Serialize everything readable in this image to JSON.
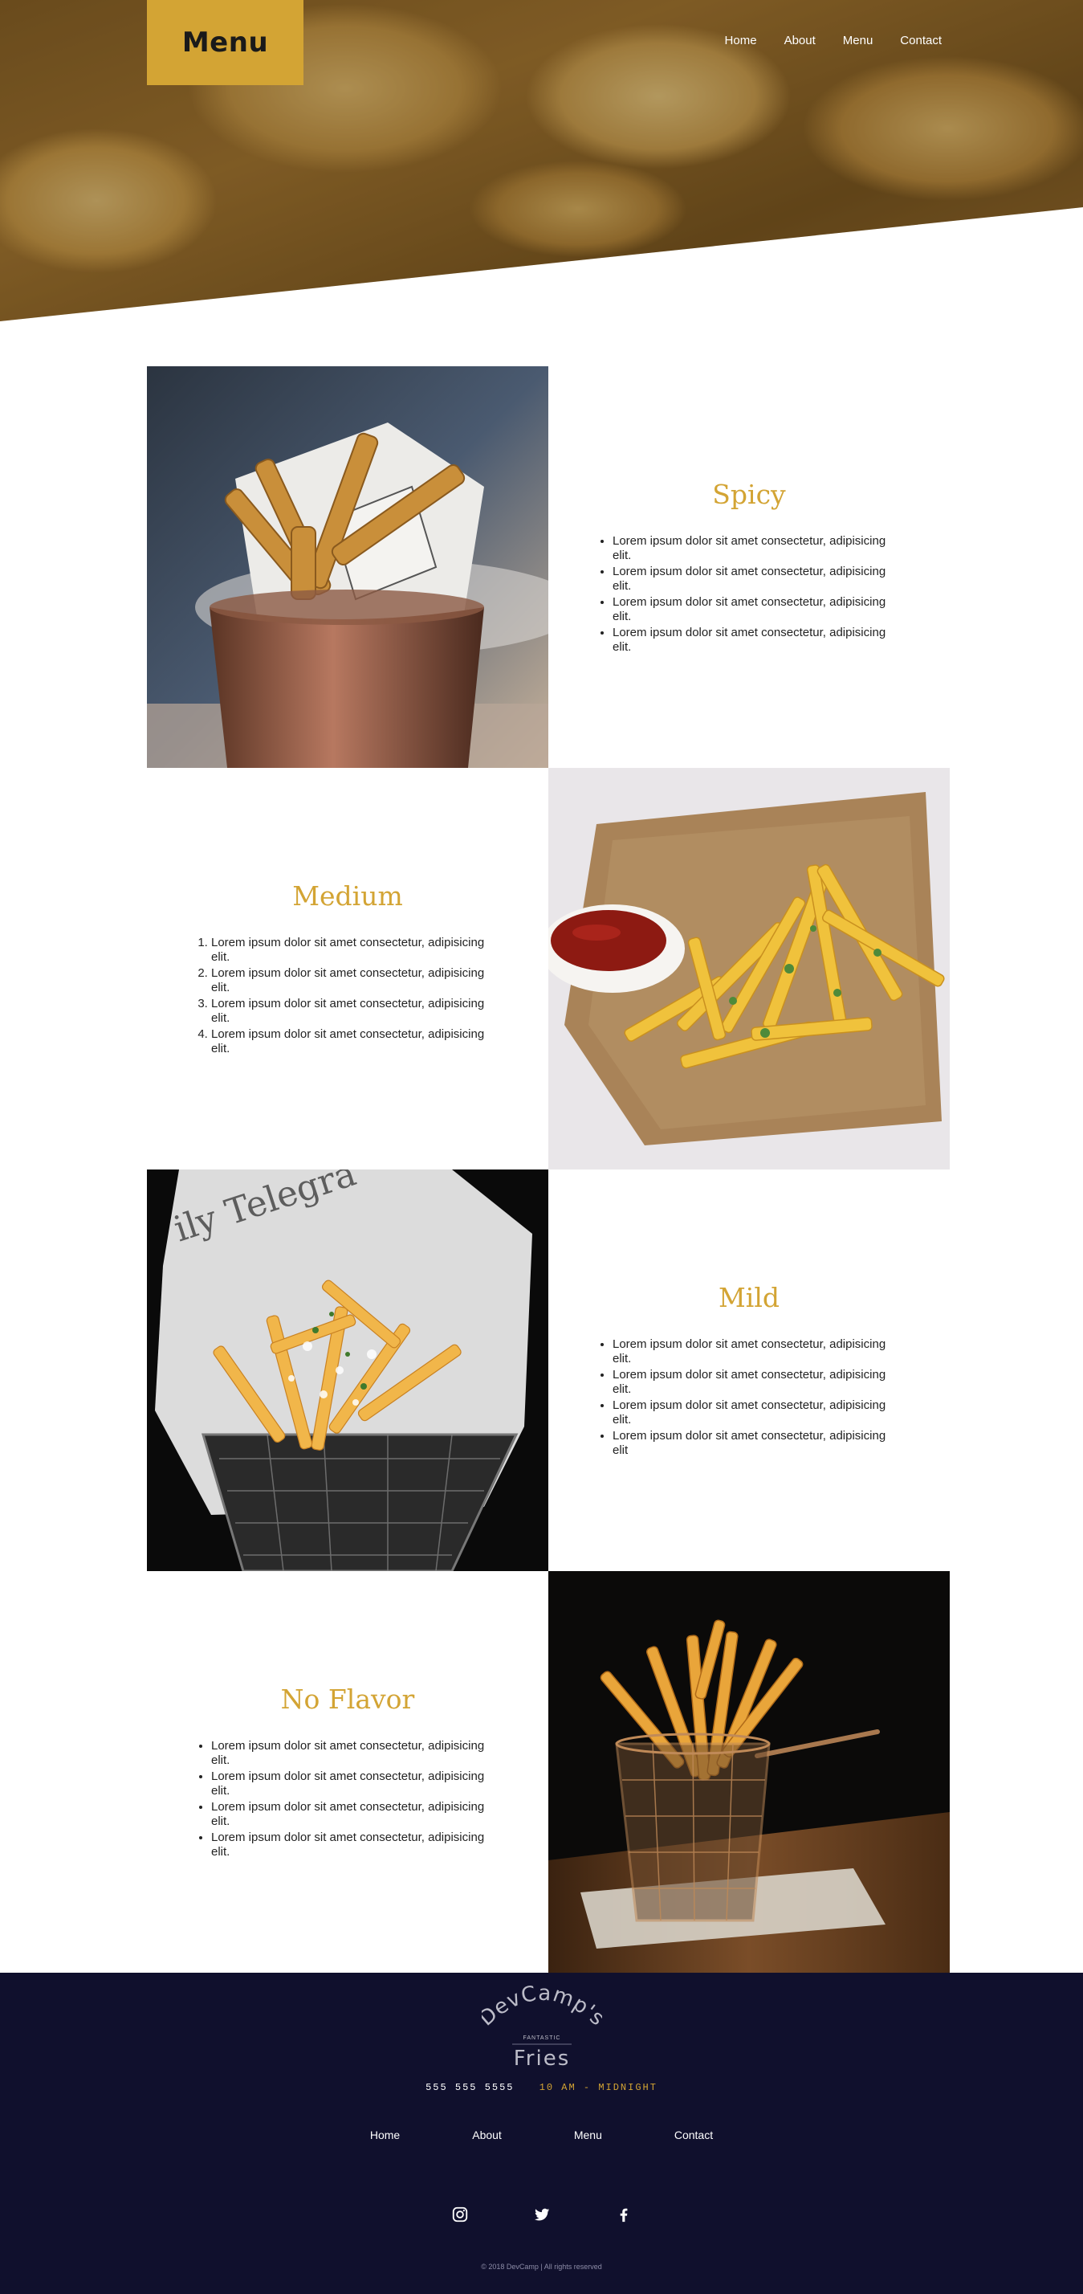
{
  "colors": {
    "accent": "#d3a434",
    "footer_bg": "#10102d",
    "text": "#222222"
  },
  "header": {
    "brand_label": "Menu",
    "nav": [
      "Home",
      "About",
      "Menu",
      "Contact"
    ]
  },
  "menu": {
    "items": [
      {
        "title": "Spicy",
        "list_type": "bulleted",
        "bullets": [
          "Lorem ipsum dolor sit amet consectetur, adipisicing elit.",
          "Lorem ipsum dolor sit amet consectetur, adipisicing elit.",
          "Lorem ipsum dolor sit amet consectetur, adipisicing elit.",
          "Lorem ipsum dolor sit amet consectetur, adipisicing elit."
        ],
        "image": "fries in copper cup with paper wrap"
      },
      {
        "title": "Medium",
        "list_type": "numbered",
        "bullets": [
          "Lorem ipsum dolor sit amet consectetur, adipisicing elit.",
          "Lorem ipsum dolor sit amet consectetur, adipisicing elit.",
          "Lorem ipsum dolor sit amet consectetur, adipisicing elit.",
          "Lorem ipsum dolor sit amet consectetur, adipisicing elit."
        ],
        "image": "fries with ketchup on brown paper"
      },
      {
        "title": "Mild",
        "list_type": "bulleted",
        "bullets": [
          "Lorem ipsum dolor sit amet consectetur, adipisicing elit.",
          "Lorem ipsum dolor sit amet consectetur, adipisicing elit.",
          "Lorem ipsum dolor sit amet consectetur, adipisicing elit.",
          "Lorem ipsum dolor sit amet consectetur, adipisicing elit"
        ],
        "image": "fries in wire basket with newspaper"
      },
      {
        "title": "No Flavor",
        "list_type": "bulleted",
        "bullets": [
          "Lorem ipsum dolor sit amet consectetur, adipisicing elit.",
          "Lorem ipsum dolor sit amet consectetur, adipisicing elit.",
          "Lorem ipsum dolor sit amet consectetur, adipisicing elit.",
          "Lorem ipsum dolor sit amet consectetur, adipisicing elit."
        ],
        "image": "fries in copper fry basket on wooden table"
      }
    ]
  },
  "footer": {
    "logo": {
      "line1": "DevCamp's",
      "line2": "FANTASTIC",
      "line3": "Fries"
    },
    "phone": "555 555 5555",
    "hours": "10 AM - MIDNIGHT",
    "nav": [
      "Home",
      "About",
      "Menu",
      "Contact"
    ],
    "social_icons": [
      "instagram-icon",
      "twitter-icon",
      "facebook-icon"
    ],
    "copyright": "© 2018 DevCamp | All rights reserved"
  }
}
